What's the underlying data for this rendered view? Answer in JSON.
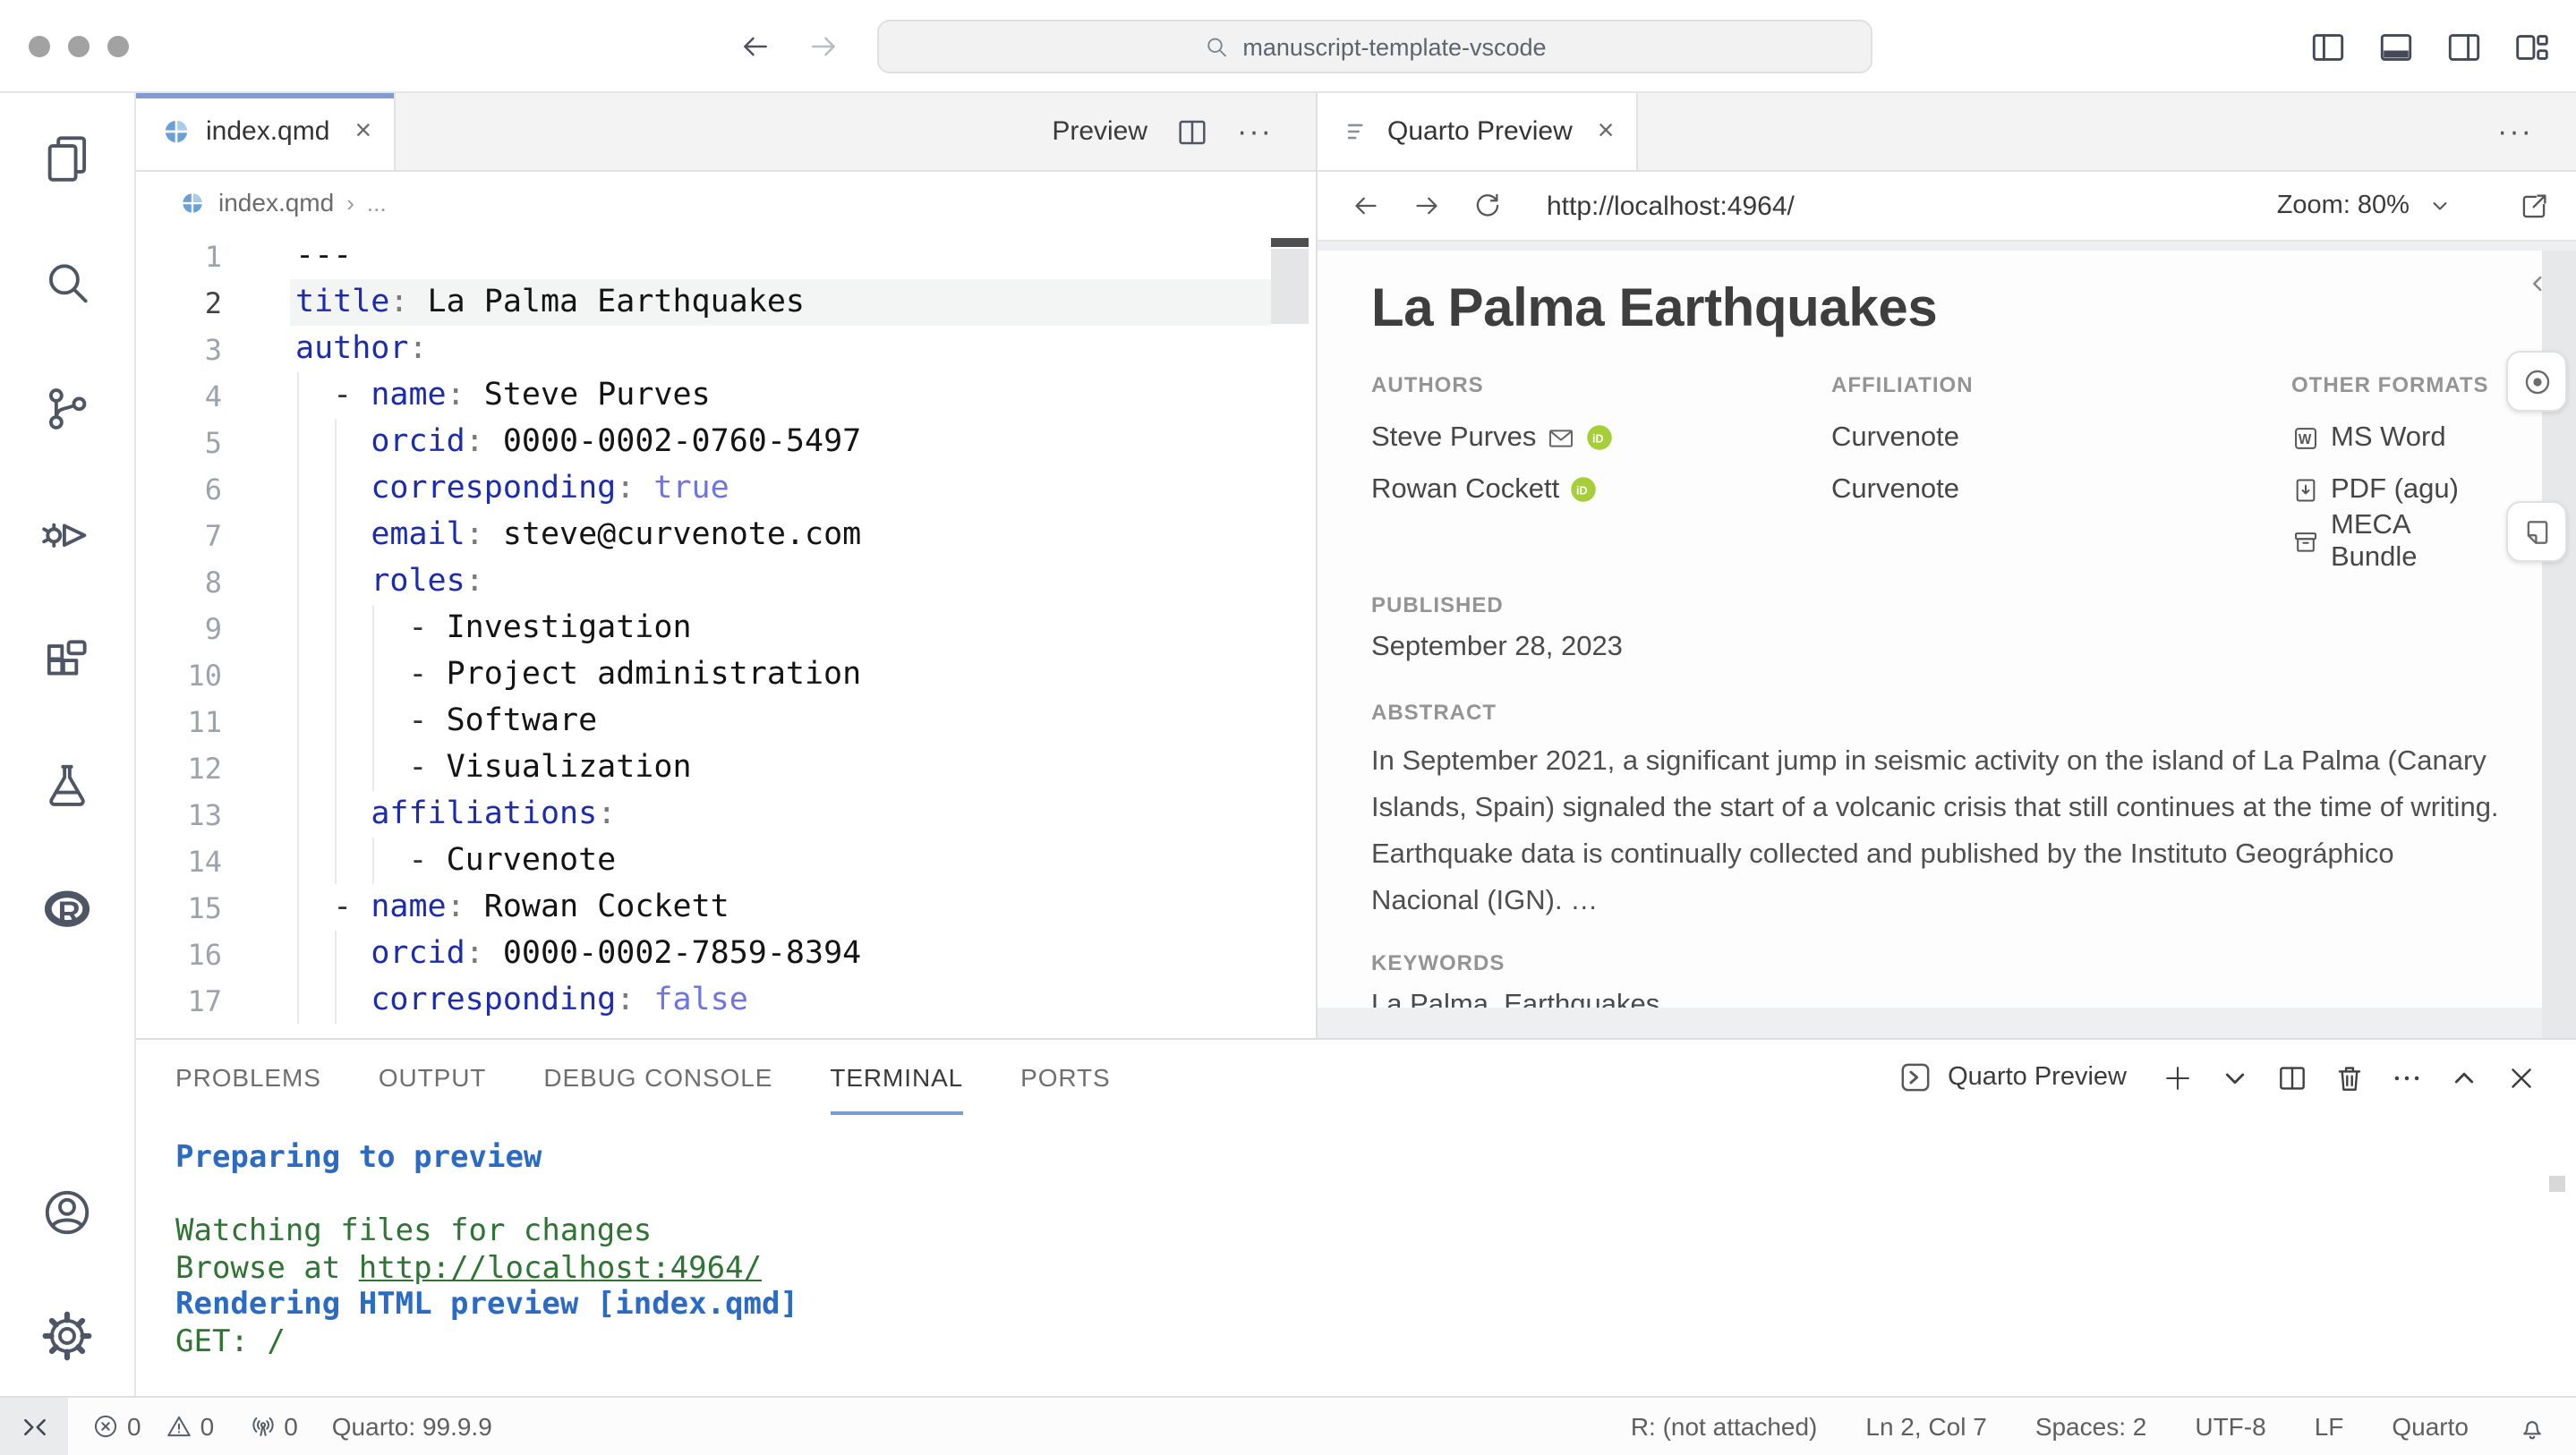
{
  "window": {
    "search": "manuscript-template-vscode",
    "controls": [
      "window-dot",
      "window-dot",
      "window-dot"
    ],
    "nav_icons": [
      "arrow-left",
      "arrow-right"
    ],
    "layout_icons": [
      "panel-left",
      "panel-bottom",
      "panel-right",
      "layout-customize"
    ]
  },
  "activity_bar": {
    "top": [
      "files-explorer",
      "search",
      "source-control",
      "run-debug",
      "extensions",
      "testing",
      "r-lang"
    ],
    "bottom": [
      "account",
      "settings-gear"
    ]
  },
  "editor": {
    "tab": {
      "label": "index.qmd",
      "icon": "quarto"
    },
    "actions": {
      "preview_label": "Preview",
      "icons": [
        "split-editor",
        "more"
      ]
    },
    "breadcrumb": {
      "file": "index.qmd",
      "more": "..."
    },
    "code": {
      "active_line": 2,
      "cursor": "Ln 2, Col 7",
      "lines": [
        [
          {
            "t": "---",
            "c": "val"
          }
        ],
        [
          {
            "t": "title",
            "c": "key"
          },
          {
            "t": ": ",
            "c": "pn"
          },
          {
            "t": "La Palma Earthquakes",
            "c": "val"
          }
        ],
        [
          {
            "t": "author",
            "c": "key"
          },
          {
            "t": ":",
            "c": "pn"
          }
        ],
        [
          {
            "t": "  - ",
            "c": "dash"
          },
          {
            "t": "name",
            "c": "key"
          },
          {
            "t": ": ",
            "c": "pn"
          },
          {
            "t": "Steve Purves",
            "c": "val"
          }
        ],
        [
          {
            "t": "    ",
            "c": "dash"
          },
          {
            "t": "orcid",
            "c": "key"
          },
          {
            "t": ": ",
            "c": "pn"
          },
          {
            "t": "0000-0002-0760-5497",
            "c": "val"
          }
        ],
        [
          {
            "t": "    ",
            "c": "dash"
          },
          {
            "t": "corresponding",
            "c": "key"
          },
          {
            "t": ": ",
            "c": "pn"
          },
          {
            "t": "true",
            "c": "bool"
          }
        ],
        [
          {
            "t": "    ",
            "c": "dash"
          },
          {
            "t": "email",
            "c": "key"
          },
          {
            "t": ": ",
            "c": "pn"
          },
          {
            "t": "steve@curvenote.com",
            "c": "val"
          }
        ],
        [
          {
            "t": "    ",
            "c": "dash"
          },
          {
            "t": "roles",
            "c": "key"
          },
          {
            "t": ":",
            "c": "pn"
          }
        ],
        [
          {
            "t": "      - ",
            "c": "dash"
          },
          {
            "t": "Investigation",
            "c": "val"
          }
        ],
        [
          {
            "t": "      - ",
            "c": "dash"
          },
          {
            "t": "Project administration",
            "c": "val"
          }
        ],
        [
          {
            "t": "      - ",
            "c": "dash"
          },
          {
            "t": "Software",
            "c": "val"
          }
        ],
        [
          {
            "t": "      - ",
            "c": "dash"
          },
          {
            "t": "Visualization",
            "c": "val"
          }
        ],
        [
          {
            "t": "    ",
            "c": "dash"
          },
          {
            "t": "affiliations",
            "c": "key"
          },
          {
            "t": ":",
            "c": "pn"
          }
        ],
        [
          {
            "t": "      - ",
            "c": "dash"
          },
          {
            "t": "Curvenote",
            "c": "val"
          }
        ],
        [
          {
            "t": "  - ",
            "c": "dash"
          },
          {
            "t": "name",
            "c": "key"
          },
          {
            "t": ": ",
            "c": "pn"
          },
          {
            "t": "Rowan Cockett",
            "c": "val"
          }
        ],
        [
          {
            "t": "    ",
            "c": "dash"
          },
          {
            "t": "orcid",
            "c": "key"
          },
          {
            "t": ": ",
            "c": "pn"
          },
          {
            "t": "0000-0002-7859-8394",
            "c": "val"
          }
        ],
        [
          {
            "t": "    ",
            "c": "dash"
          },
          {
            "t": "corresponding",
            "c": "key"
          },
          {
            "t": ": ",
            "c": "pn"
          },
          {
            "t": "false",
            "c": "bool"
          }
        ]
      ]
    }
  },
  "preview": {
    "tab_label": "Quarto Preview",
    "tab_icon": "list",
    "toolbar_icons": [
      "arrow-left",
      "arrow-right",
      "refresh"
    ],
    "url": "http://localhost:4964/",
    "zoom_label": "Zoom: 80%",
    "rail_icons": [
      "chevron-left",
      "eye",
      "note"
    ],
    "article": {
      "title": "La Palma Earthquakes",
      "authors_label": "AUTHORS",
      "affiliation_label": "AFFILIATION",
      "formats_label": "OTHER FORMATS",
      "authors": [
        {
          "name": "Steve Purves",
          "icons": [
            "envelope",
            "orcid"
          ]
        },
        {
          "name": "Rowan Cockett",
          "icons": [
            "orcid"
          ]
        }
      ],
      "affiliations": [
        "Curvenote",
        "Curvenote"
      ],
      "formats": [
        {
          "icon": "ms-word",
          "label": "MS Word"
        },
        {
          "icon": "pdf",
          "label": "PDF (agu)"
        },
        {
          "icon": "meca",
          "label": "MECA Bundle"
        }
      ],
      "published_label": "PUBLISHED",
      "published": "September 28, 2023",
      "abstract_label": "ABSTRACT",
      "abstract": "In September 2021, a significant jump in seismic activity on the island of La Palma (Canary Islands, Spain) signaled the start of a volcanic crisis that still continues at the time of writing. Earthquake data is continually collected and published by the Instituto Geográphico Nacional (IGN). …",
      "keywords_label": "KEYWORDS",
      "keywords": "La Palma, Earthquakes"
    }
  },
  "panel": {
    "tabs": [
      "PROBLEMS",
      "OUTPUT",
      "DEBUG CONSOLE",
      "TERMINAL",
      "PORTS"
    ],
    "active_tab": "TERMINAL",
    "terminal_title": "Quarto Preview",
    "terminal_icon": "terminal-box",
    "action_icons": [
      "add",
      "chevron-down",
      "split-editor",
      "trash",
      "more",
      "chevron-up",
      "close"
    ],
    "lines": [
      {
        "text": "Preparing to preview",
        "style": "info"
      },
      {
        "text": "",
        "style": "ok"
      },
      {
        "text": "Watching files for changes",
        "style": "ok"
      },
      {
        "prefix": "Browse at ",
        "link": "http://localhost:4964/",
        "style": "ok"
      },
      {
        "text": "Rendering HTML preview [index.qmd]",
        "style": "info"
      },
      {
        "text": "GET: /",
        "style": "ok"
      }
    ]
  },
  "status_bar": {
    "left": [
      {
        "icon": "remote",
        "kind": "block"
      },
      {
        "icon": "error",
        "text": "0"
      },
      {
        "icon": "warning",
        "text": "0"
      },
      {
        "icon": "broadcast",
        "text": "0",
        "gap": true
      },
      {
        "text": "Quarto: 99.9.9",
        "gap": true
      }
    ],
    "right": [
      {
        "text": "R: (not attached)"
      },
      {
        "text": "Ln 2, Col 7"
      },
      {
        "text": "Spaces: 2"
      },
      {
        "text": "UTF-8"
      },
      {
        "text": "LF"
      },
      {
        "text": "Quarto"
      },
      {
        "icon": "bell"
      }
    ]
  },
  "colors": {
    "tab_accent": "#7f9dd0",
    "terminal_blue": "#2b6bc3",
    "terminal_green": "#2e7433",
    "orcid_green": "#a6ce39",
    "quarto_blue": "#69a0d7"
  }
}
